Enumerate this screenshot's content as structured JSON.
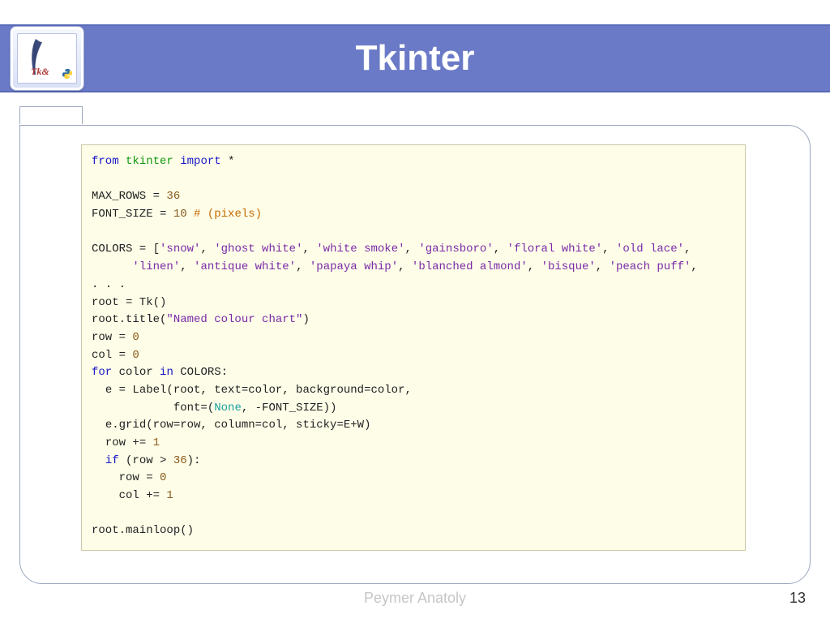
{
  "header": {
    "title": "Tkinter"
  },
  "logo": {
    "tk_label": "Tk&"
  },
  "code": {
    "l1a": "from",
    "l1b": "tkinter",
    "l1c": "import",
    "l1d": "*",
    "l3": "MAX_ROWS = ",
    "l3n": "36",
    "l4": "FONT_SIZE = ",
    "l4n": "10",
    "l4c": "# (pixels)",
    "l6": "COLORS = [",
    "c1": "'snow'",
    "c2": "'ghost white'",
    "c3": "'white smoke'",
    "c4": "'gainsboro'",
    "c5": "'floral white'",
    "c6": "'old lace'",
    "c7": "'linen'",
    "c8": "'antique white'",
    "c9": "'papaya whip'",
    "c10": "'blanched almond'",
    "c11": "'bisque'",
    "c12": "'peach puff'",
    "l9": ". . .",
    "l10a": "root = Tk()",
    "l11a": "root.title(",
    "l11s": "\"Named colour chart\"",
    "l11b": ")",
    "l12": "row = ",
    "l12n": "0",
    "l13": "col = ",
    "l13n": "0",
    "l14a": "for",
    "l14b": "color",
    "l14c": "in",
    "l14d": "COLORS:",
    "l15a": "  e = Label(root, text=color, background=color,",
    "l16a": "            font=(",
    "l16b": "None",
    "l16c": ", -FONT_SIZE))",
    "l17": "  e.grid(row=row, column=col, sticky=E+W)",
    "l18a": "  row += ",
    "l18n": "1",
    "l19a": "  ",
    "l19b": "if",
    "l19c": " (row > ",
    "l19n": "36",
    "l19d": "):",
    "l20a": "    row = ",
    "l20n": "0",
    "l21a": "    col += ",
    "l21n": "1",
    "l23": "root.mainloop()",
    "comma": ", ",
    "comma_close": ","
  },
  "footer": {
    "author": "Peymer Anatoly",
    "page": "13"
  }
}
